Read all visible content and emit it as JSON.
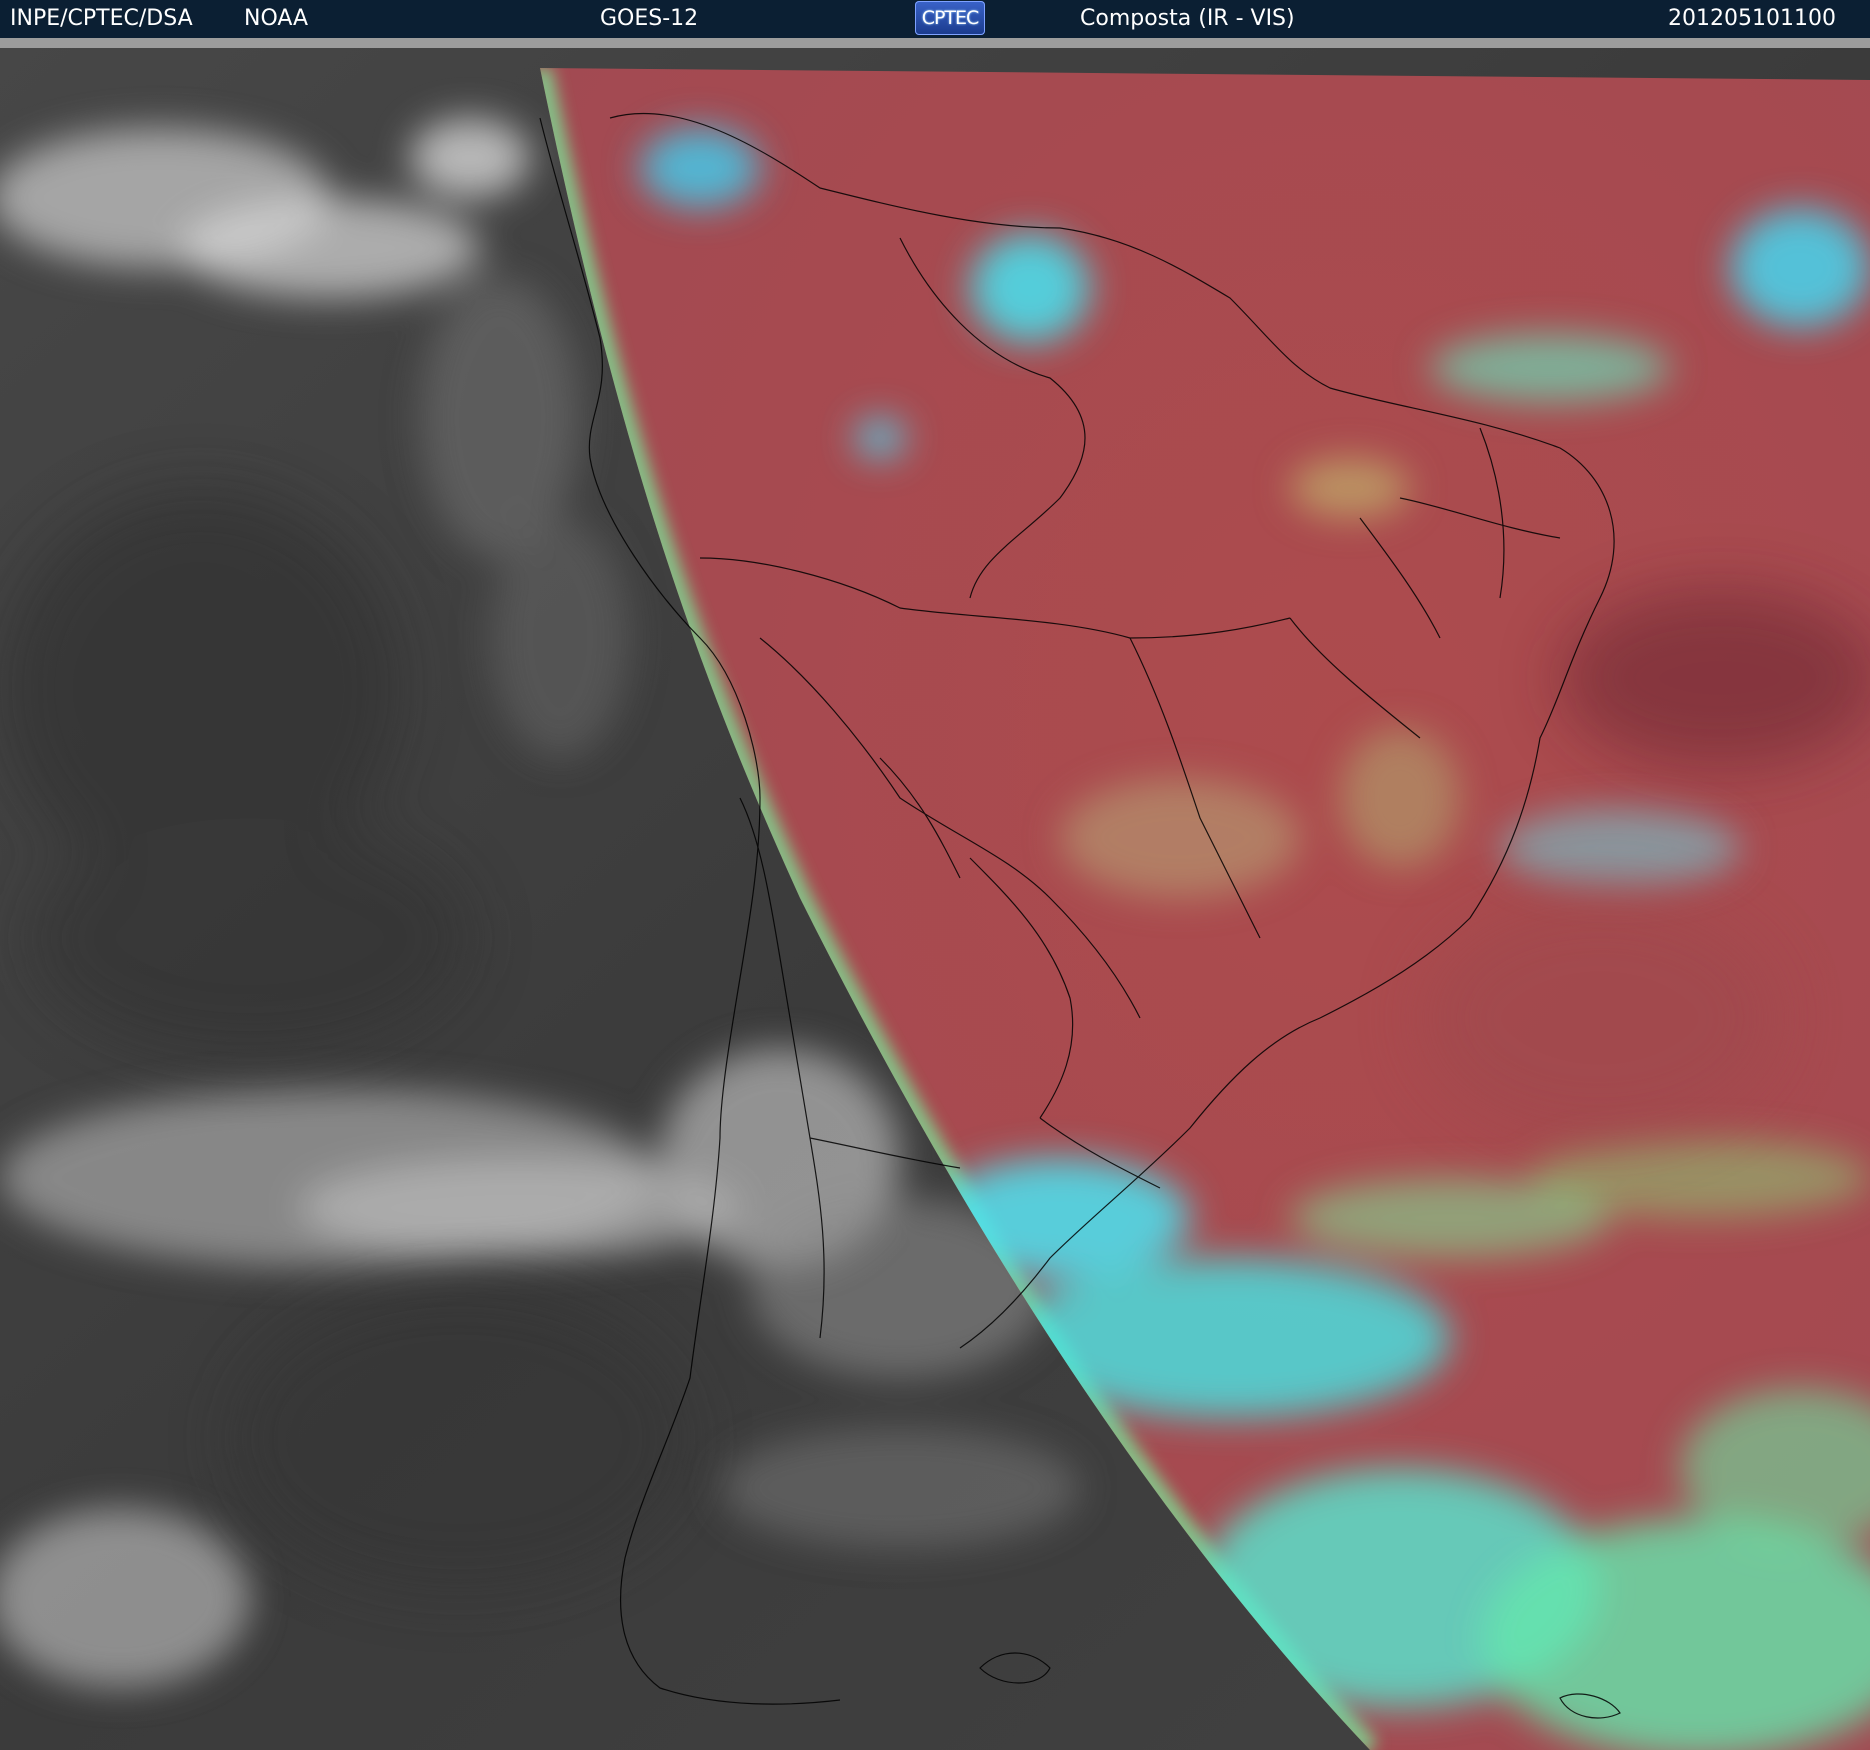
{
  "header": {
    "institution": "INPE/CPTEC/DSA",
    "agency": "NOAA",
    "satellite": "GOES-12",
    "logo_text": "CPTEC",
    "product": "Composta (IR - VIS)",
    "timestamp": "201205101100"
  },
  "colors": {
    "header_bg": "#0b1f33",
    "night_ir": "#3c3c3c",
    "day_land_ocean": "#a84a4a",
    "cloud_cyan": "#44e0f0",
    "cloud_green": "#79f099",
    "border_lines": "#000000"
  }
}
